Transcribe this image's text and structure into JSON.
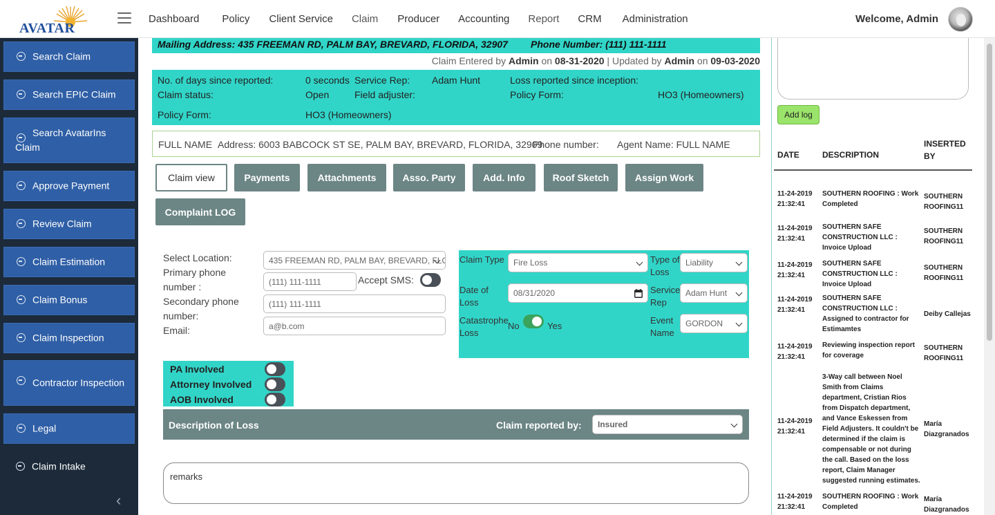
{
  "logo": {
    "text": "AVATAR"
  },
  "nav": {
    "items": [
      "Dashboard",
      "Policy",
      "Client Service",
      "Claim",
      "Producer",
      "Accounting",
      "Report",
      "CRM",
      "Administration"
    ]
  },
  "user": {
    "welcome": "Welcome, Admin"
  },
  "sidebar": {
    "items": [
      "Search Claim",
      "Search EPIC Claim",
      "Search AvatarIns Claim",
      "Approve Payment",
      "Review Claim",
      "Claim Estimation",
      "Claim Bonus",
      "Claim Inspection",
      "Contractor Inspection",
      "Legal",
      "Claim Intake"
    ],
    "collapse_icon": "chevron-left-icon"
  },
  "header": {
    "mailing": "Mailing Address: 435 FREEMAN RD, PALM BAY, BREVARD, FLORIDA, 32907",
    "phone": "Phone Number: (111) 111-1111",
    "entered_prefix": "Claim Entered by",
    "entered_by": "Admin",
    "on1": "on",
    "entered_date": "08-31-2020",
    "sep": "|",
    "updated_prefix": "Updated by",
    "updated_by": "Admin",
    "on2": "on",
    "updated_date": "09-03-2020"
  },
  "info": {
    "days_label": "No. of days since reported:",
    "days_value": "0 seconds",
    "service_rep_label": "Service Rep:",
    "service_rep_value": "Adam Hunt",
    "loss_reported_label": "Loss reported since inception:",
    "status_label": "Claim status:",
    "status_value": "Open",
    "field_adjuster_label": "Field adjuster:",
    "policy_form_label_r": "Policy Form:",
    "policy_form_value_r": "HO3 (Homeowners)",
    "policy_form_label": "Policy Form:",
    "policy_form_value": "HO3 (Homeowners)"
  },
  "insured": {
    "full_name": "FULL NAME",
    "address": "Address: 6003 BABCOCK ST SE, PALM BAY, BREVARD, FLORIDA, 32909",
    "phone": "Phone number:",
    "agent": "Agent Name: FULL NAME"
  },
  "tabs": [
    "Claim view",
    "Payments",
    "Attachments",
    "Asso. Party",
    "Add. Info",
    "Roof Sketch",
    "Assign Work",
    "Complaint LOG"
  ],
  "form": {
    "location_label": "Select Location:",
    "location_value": "435 FREEMAN RD, PALM BAY, BREVARD, FLORIDA",
    "primary_label": "Primary phone number :",
    "primary_value": "(111) 111-1111",
    "sms_label": "Accept SMS:",
    "secondary_label": "Secondary phone number:",
    "secondary_value": "(111) 111-1111",
    "email_label": "Email:",
    "email_value": "a@b.com"
  },
  "claim": {
    "type_label": "Claim Type",
    "type_value": "Fire Loss",
    "type_of_loss_label": "Type of Loss",
    "type_of_loss_value": "Liability",
    "date_label": "Date of Loss",
    "date_value": "08/31/2020",
    "service_rep_label": "Service Rep",
    "service_rep_value": "Adam Hunt",
    "catastrophe_label": "Catastrophe Loss",
    "no": "No",
    "yes": "Yes",
    "event_label": "Event Name",
    "event_value": "GORDON"
  },
  "involved": {
    "pa": "PA Involved",
    "attorney": "Attorney Involved",
    "aob": "AOB Involved"
  },
  "desc": {
    "title": "Description of Loss",
    "reported_label": "Claim reported by:",
    "reported_value": "Insured"
  },
  "remarks": {
    "value": "remarks"
  },
  "log": {
    "add_label": "Add log",
    "headers": {
      "date": "DATE",
      "description": "DESCRIPTION",
      "inserted": "INSERTED BY"
    },
    "rows": [
      {
        "date": "11-24-2019 21:32:41",
        "desc": "SOUTHERN ROOFING : Work Completed",
        "by": "SOUTHERN ROOFING11"
      },
      {
        "date": "11-24-2019 21:32:41",
        "desc": "SOUTHERN SAFE CONSTRUCTION LLC : Invoice Upload",
        "by": "SOUTHERN ROOFING11"
      },
      {
        "date": "11-24-2019 21:32:41",
        "desc": "SOUTHERN SAFE CONSTRUCTION LLC : Invoice Upload",
        "by": "SOUTHERN ROOFING11"
      },
      {
        "date": "11-24-2019 21:32:41",
        "desc": "SOUTHERN SAFE CONSTRUCTION LLC : Assigned to contractor for Estimamtes",
        "by": "Deiby Callejas"
      },
      {
        "date": "11-24-2019 21:32:41",
        "desc": "Reviewing inspection report for coverage",
        "by": "SOUTHERN ROOFING11"
      },
      {
        "date": "11-24-2019 21:32:41",
        "desc": "3-Way call between Noel Smith from Claims department, Cristian Rios from Dispatch department, and Vance Eskessen from Field Adjusters. It couldn't be determined if the claim is compensable or not during the call. Based on the loss report, Claim Manager suggested running estimates.",
        "by": "María Diazgranados"
      },
      {
        "date": "11-24-2019 21:32:41",
        "desc": "SOUTHERN ROOFING : Work Completed",
        "by": "María Diazgranados"
      }
    ]
  }
}
